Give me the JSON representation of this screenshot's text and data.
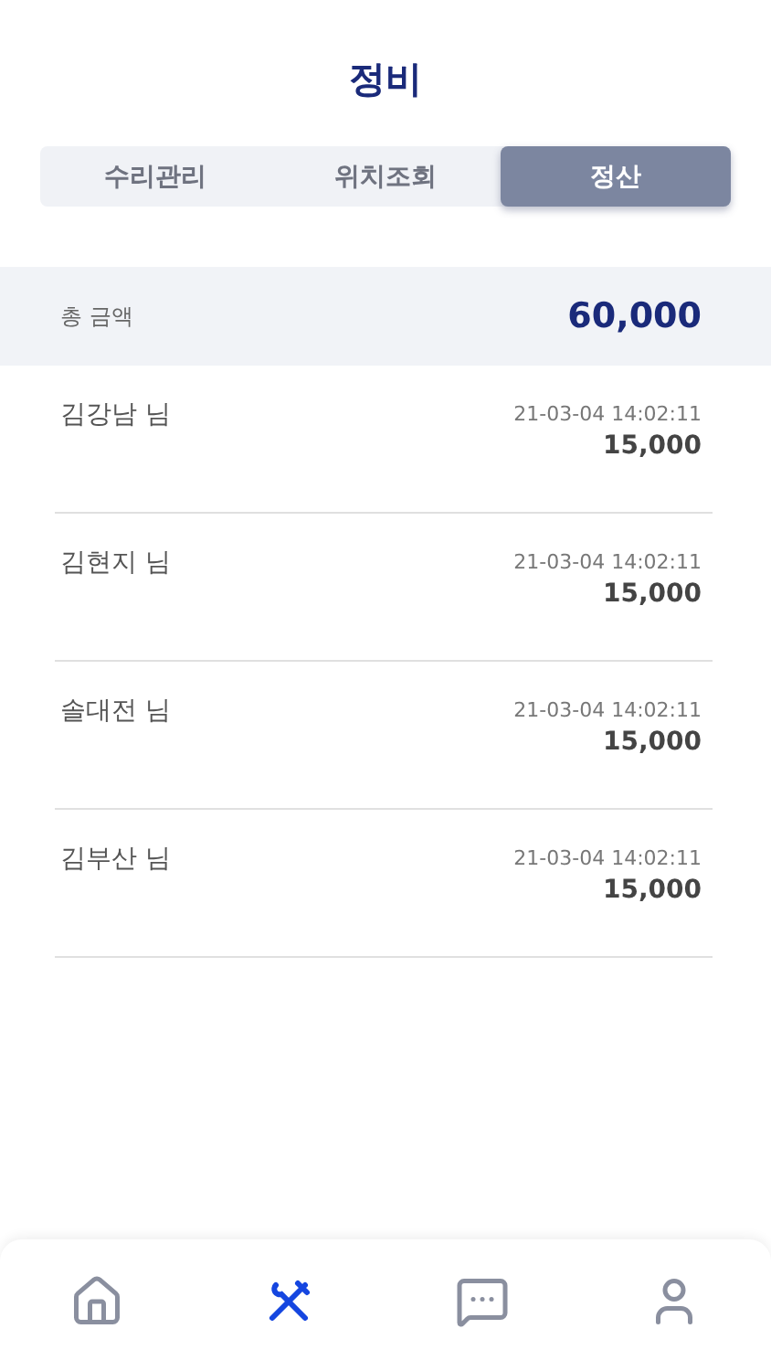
{
  "header": {
    "title": "정비"
  },
  "tabs": [
    {
      "label": "수리관리",
      "selected": false
    },
    {
      "label": "위치조회",
      "selected": false
    },
    {
      "label": "정산",
      "selected": true
    }
  ],
  "total": {
    "label": "총 금액",
    "amount": "60,000"
  },
  "payments": [
    {
      "name": "김강남 님",
      "time": "21-03-04 14:02:11",
      "amount": "15,000"
    },
    {
      "name": "김현지 님",
      "time": "21-03-04 14:02:11",
      "amount": "15,000"
    },
    {
      "name": "솔대전 님",
      "time": "21-03-04 14:02:11",
      "amount": "15,000"
    },
    {
      "name": "김부산 님",
      "time": "21-03-04 14:02:11",
      "amount": "15,000"
    }
  ],
  "nav": [
    {
      "kind": "home",
      "selected": false
    },
    {
      "kind": "tools",
      "selected": true
    },
    {
      "kind": "chat",
      "selected": false
    },
    {
      "kind": "profile",
      "selected": false
    }
  ]
}
